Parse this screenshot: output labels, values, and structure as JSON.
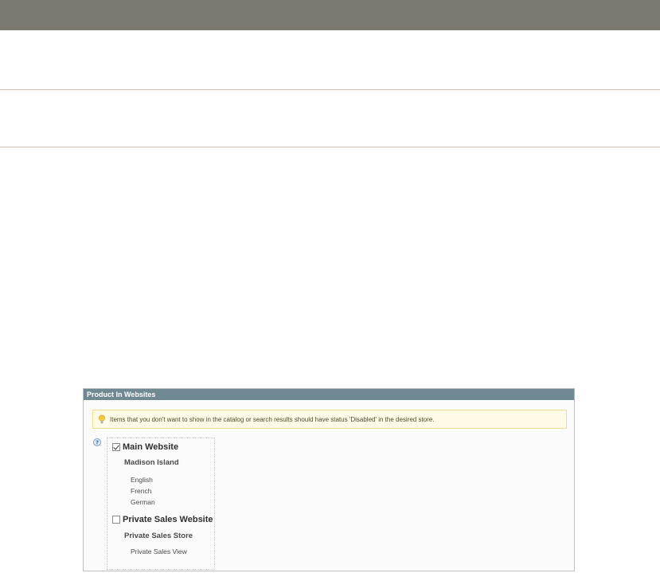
{
  "panel": {
    "title": "Product In Websites",
    "notice": "Items that you don't want to show in the catalog or search results should have status 'Disabled' in the desired store."
  },
  "websites": [
    {
      "name": "Main Website",
      "checked": true,
      "store": "Madison Island",
      "views": [
        "English",
        "French",
        "German"
      ]
    },
    {
      "name": "Private Sales Website",
      "checked": false,
      "store": "Private Sales Store",
      "views": [
        "Private Sales View"
      ]
    }
  ],
  "colors": {
    "topbar": "#7b786f",
    "panel_header": "#6f8992",
    "notice_bg": "#fffbe7",
    "notice_border": "#f2dc8f"
  },
  "icons": {
    "notice": "lightbulb-icon",
    "help": "help-icon"
  }
}
